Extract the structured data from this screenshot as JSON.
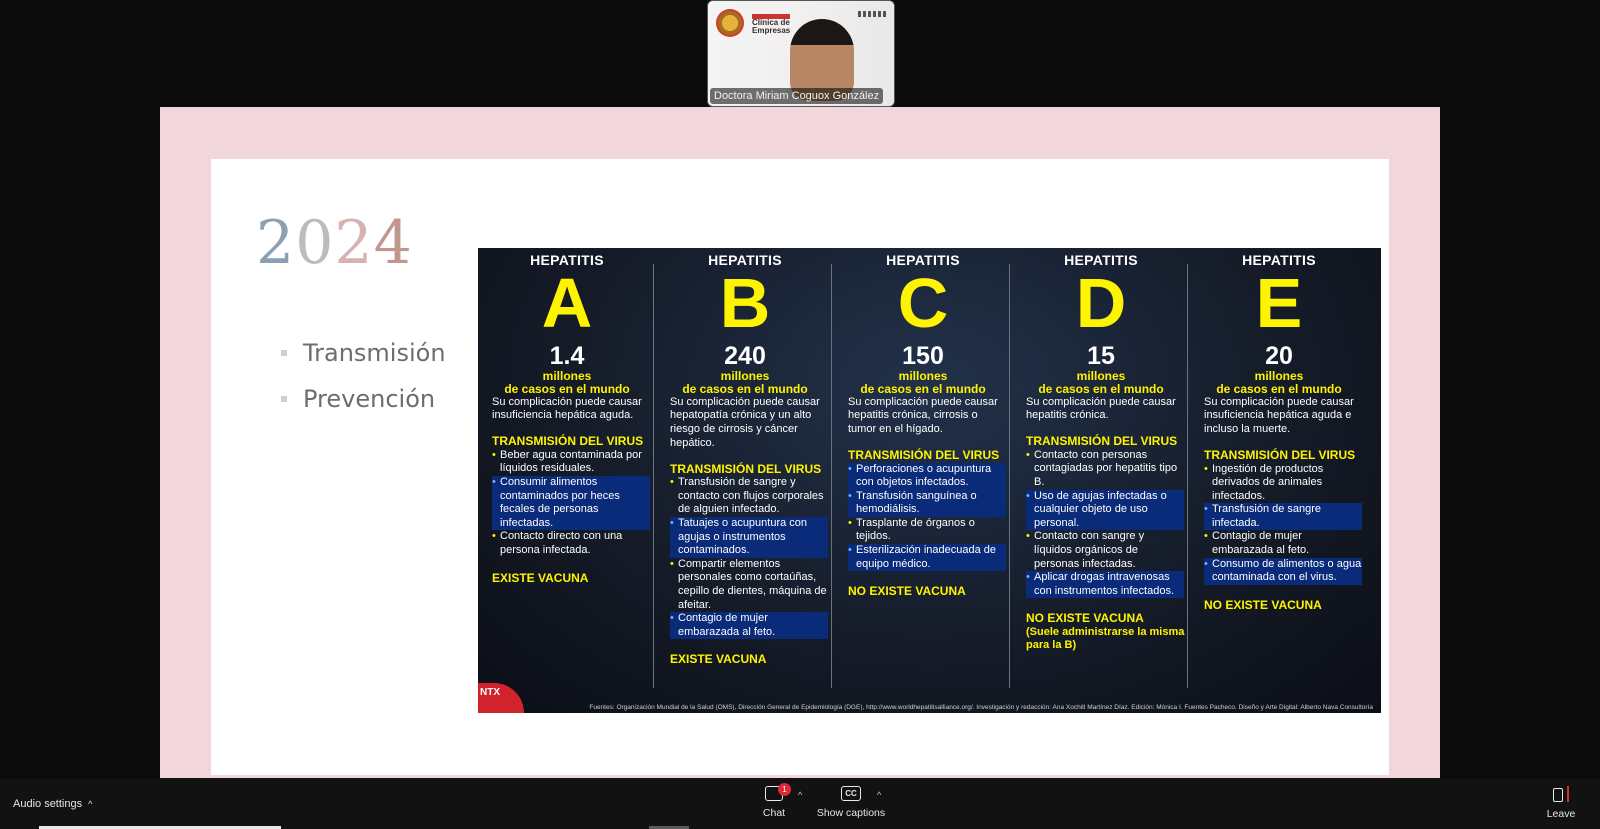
{
  "speaker": {
    "name": "Doctora Miriam Coguox González",
    "brand": "Clínica de Empresas"
  },
  "slide": {
    "year": [
      "2",
      "0",
      "2",
      "4"
    ],
    "bullets": [
      "Transmisión",
      "Prevención"
    ]
  },
  "infographic": {
    "columns": [
      {
        "heading": "HEPATITIS",
        "letter": "A",
        "count": "1.4",
        "unit": "millones",
        "cases": "de casos en el mundo",
        "complication": "Su complicación puede causar insuficiencia hepática aguda.",
        "transmission_title": "TRANSMISIÓN DEL VIRUS",
        "items": [
          "Beber agua contaminada por líquidos residuales.",
          "Consumir alimentos contaminados por heces fecales de personas infectadas.",
          "Contacto directo con una persona infectada."
        ],
        "vaccine": "EXISTE VACUNA",
        "vaccine_note": ""
      },
      {
        "heading": "HEPATITIS",
        "letter": "B",
        "count": "240",
        "unit": "millones",
        "cases": "de casos en el mundo",
        "complication": "Su complicación puede causar hepatopatía crónica y un alto riesgo de cirrosis y cáncer hepático.",
        "transmission_title": "TRANSMISIÓN DEL VIRUS",
        "items": [
          "Transfusión de sangre y contacto con flujos corporales de alguien infectado.",
          "Tatuajes o acupuntura con agujas o instrumentos contaminados.",
          "Compartir elementos personales como cortaúñas, cepillo de dientes, máquina de afeitar.",
          "Contagio de mujer embarazada al feto."
        ],
        "vaccine": "EXISTE VACUNA",
        "vaccine_note": ""
      },
      {
        "heading": "HEPATITIS",
        "letter": "C",
        "count": "150",
        "unit": "millones",
        "cases": "de casos en el mundo",
        "complication": "Su complicación puede causar hepatitis crónica, cirrosis o tumor en el hígado.",
        "transmission_title": "TRANSMISIÓN DEL VIRUS",
        "items": [
          "Perforaciones o acupuntura con objetos infectados.",
          "Transfusión sanguínea o hemodiálisis.",
          "Trasplante de órganos o tejidos.",
          "Esterilización inadecuada de equipo médico."
        ],
        "vaccine": "NO EXISTE VACUNA",
        "vaccine_note": ""
      },
      {
        "heading": "HEPATITIS",
        "letter": "D",
        "count": "15",
        "unit": "millones",
        "cases": "de casos en el mundo",
        "complication": "Su complicación puede causar hepatitis crónica.",
        "transmission_title": "TRANSMISIÓN DEL VIRUS",
        "items": [
          "Contacto con personas contagiadas por hepatitis tipo B.",
          "Uso de agujas infectadas o cualquier objeto de uso personal.",
          "Contacto con sangre y líquidos orgánicos de personas infectadas.",
          "Aplicar drogas intravenosas con instrumentos infectados."
        ],
        "vaccine": "NO EXISTE VACUNA",
        "vaccine_note": "(Suele administrarse la misma para la B)"
      },
      {
        "heading": "HEPATITIS",
        "letter": "E",
        "count": "20",
        "unit": "millones",
        "cases": "de casos en el mundo",
        "complication": "Su complicación puede causar insuficiencia hepática aguda e incluso la muerte.",
        "transmission_title": "TRANSMISIÓN DEL VIRUS",
        "items": [
          "Ingestión de productos derivados de animales infectados.",
          "Transfusión de sangre infectada.",
          "Contagio de mujer embarazada al feto.",
          "Consumo de alimentos o agua contaminada con el virus."
        ],
        "vaccine": "NO EXISTE VACUNA",
        "vaccine_note": ""
      }
    ],
    "highlighted": [
      [
        1
      ],
      [
        1,
        3
      ],
      [
        0,
        1,
        3
      ],
      [
        1,
        3
      ],
      [
        1,
        3
      ]
    ],
    "sources": "Fuentes: Organización Mundial de la Salud (OMS), Dirección General de Epidemiología (DGE), http://www.worldhepatitisalliance.org/. Investigación y redacción: Ana Xochitl Martínez Díaz. Edición: Mónica I. Fuentes Pacheco. Diseño y Arte Digital: Alberto Nava Consultoría",
    "logo": "NTX"
  },
  "toolbar": {
    "audio_settings": "Audio settings",
    "chat_label": "Chat",
    "chat_badge": "1",
    "captions_label": "Show captions",
    "cc_glyph": "CC",
    "leave_label": "Leave"
  }
}
